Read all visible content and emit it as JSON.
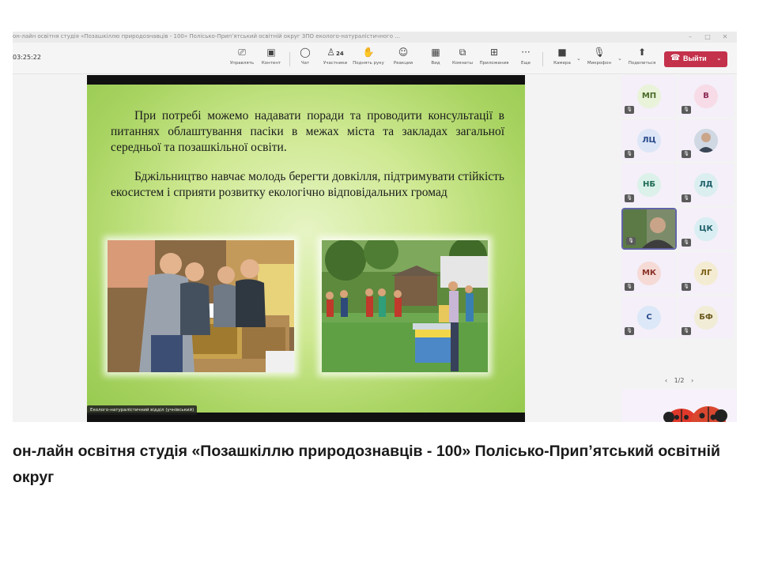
{
  "window": {
    "title": "он-лайн освітня студія «Позашкіллю природознавців - 100» Полісько-Припʼятський освітній округ ЗПО еколого-натуралістичного ...",
    "minimize_icon": "minimize-icon",
    "maximize_icon": "maximize-icon",
    "close_icon": "close-icon"
  },
  "toolbar": {
    "timer": "03:25:22",
    "share_label": "Управлять",
    "content_label": "Контент",
    "chat_label": "Чат",
    "participants_label": "Участники",
    "participants_count": "24",
    "raise_label": "Поднять руку",
    "reactions_label": "Реакции",
    "view_label": "Вид",
    "rooms_label": "Комнаты",
    "apps_label": "Приложения",
    "more_label": "Еще",
    "camera_label": "Камера",
    "mic_label": "Микрофон",
    "share_screen_label": "Поделиться",
    "leave_label": "Выйти",
    "more_glyph": "···"
  },
  "slide": {
    "paragraph1": "При потребі можемо надавати поради та проводити консультації в питаннях облаштування пасіки в межах міста та закладах загальної середньої та позашкільної освіти.",
    "paragraph2": "Бджільництво навчає молодь берегти довкілля, підтримувати стійкість екосистем і сприяти розвитку екологічно відповідальних громад",
    "presenter_chip": "Еколого-натуралістичний відділ (учнівський)"
  },
  "participants": [
    {
      "initials": "МП",
      "color": "#e9f3d9",
      "text_color": "#4a6a2b"
    },
    {
      "initials": "В",
      "color": "#f7dbe6",
      "text_color": "#8b2a55"
    },
    {
      "initials": "ЛЦ",
      "color": "#dce6f7",
      "text_color": "#2a4a8b"
    },
    {
      "initials": "",
      "color": "#cfd8e3",
      "text_color": "#333333"
    },
    {
      "initials": "НБ",
      "color": "#dbf1ea",
      "text_color": "#1f6b55"
    },
    {
      "initials": "ЛД",
      "color": "#dbeef0",
      "text_color": "#1f5f6b"
    },
    {
      "initials": "",
      "color": "#7c8c6a",
      "text_color": "#ffffff"
    },
    {
      "initials": "ЦК",
      "color": "#d8eef2",
      "text_color": "#1f5f6b"
    },
    {
      "initials": "МК",
      "color": "#f6dad6",
      "text_color": "#8b3328"
    },
    {
      "initials": "ЛГ",
      "color": "#f4ecd2",
      "text_color": "#7a5d16"
    },
    {
      "initials": "С",
      "color": "#dce8f7",
      "text_color": "#2a4a8b"
    },
    {
      "initials": "БФ",
      "color": "#f1ecd6",
      "text_color": "#6b5a1f"
    }
  ],
  "pager": {
    "prev": "‹",
    "page": "1/2",
    "next": "›"
  },
  "caption": "он-лайн освітня студія «Позашкіллю природознавців - 100» Полісько-Припʼятський освітній округ",
  "icons": {
    "share": "share-icon",
    "content": "content-icon",
    "chat": "chat-icon",
    "participants": "people-icon",
    "raise": "raise-hand-icon",
    "reactions": "reactions-icon",
    "view": "view-grid-icon",
    "rooms": "rooms-icon",
    "apps": "apps-icon",
    "more": "more-icon",
    "camera": "camera-off-icon",
    "mic": "mic-off-icon",
    "share_screen": "share-screen-icon",
    "leave": "phone-icon",
    "mic_tile": "muted-mic-icon",
    "ladybug": "ladybug-icon"
  }
}
